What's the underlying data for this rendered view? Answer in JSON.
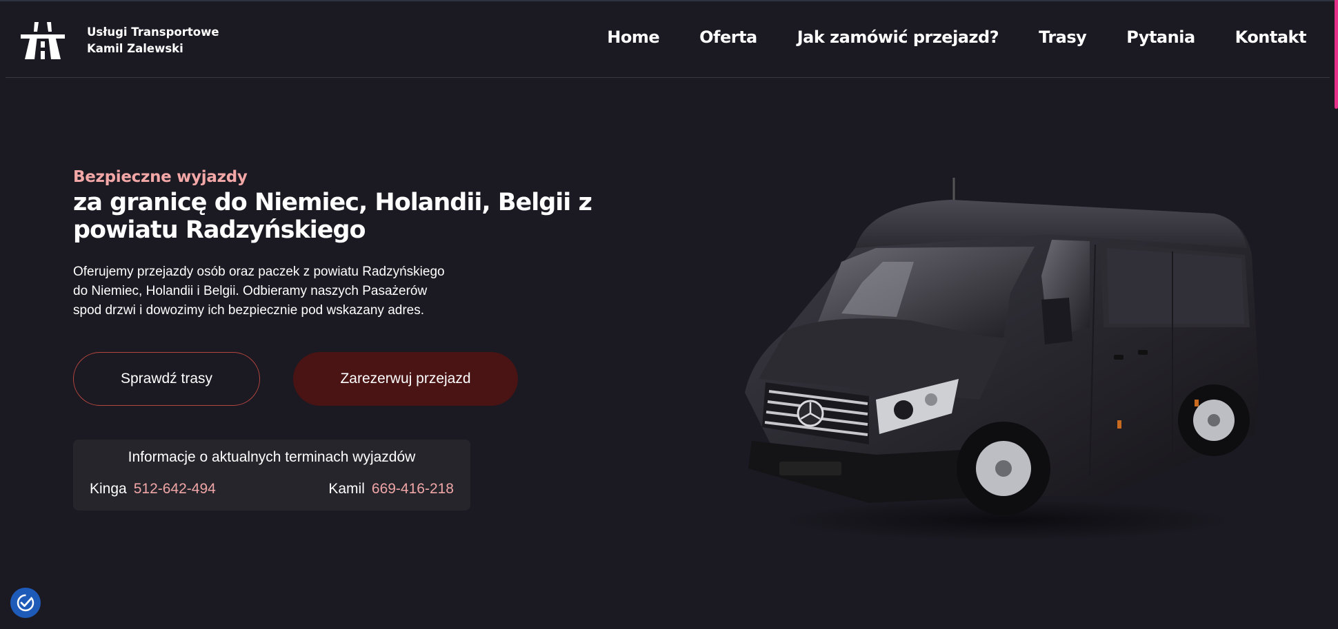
{
  "brand": {
    "line1": "Usługi Transportowe",
    "line2": "Kamil Zalewski"
  },
  "nav": {
    "items": [
      {
        "label": "Home"
      },
      {
        "label": "Oferta"
      },
      {
        "label": "Jak zamówić przejazd?"
      },
      {
        "label": "Trasy"
      },
      {
        "label": "Pytania"
      },
      {
        "label": "Kontakt"
      }
    ]
  },
  "hero": {
    "eyebrow": "Bezpieczne wyjazdy",
    "headline_line1": "za granicę do Niemiec, Holandii, Belgii z",
    "headline_line2": "powiatu Radzyńskiego",
    "lead_line1": "Oferujemy przejazdy osób oraz paczek z powiatu Radzyńskiego",
    "lead_line2": "do Niemiec, Holandii i Belgii. Odbieramy naszych Pasażerów",
    "lead_line3": "spod drzwi i dowozimy ich bezpiecznie pod wskazany adres.",
    "cta_secondary": "Sprawdź trasy",
    "cta_primary": "Zarezerwuj przejazd"
  },
  "info_card": {
    "title": "Informacje o aktualnych terminach wyjazdów",
    "contacts": [
      {
        "name": "Kinga",
        "phone": "512-642-494"
      },
      {
        "name": "Kamil",
        "phone": "669-416-218"
      }
    ]
  },
  "colors": {
    "background": "#1b1a22",
    "accent_pink": "#f3a7a7",
    "button_primary": "#4a1314",
    "button_outline": "#b4453f",
    "card": "#26252c",
    "scroll_indicator": "#e6318a",
    "a11y_button": "#1e5bb8"
  },
  "icons": {
    "logo": "highway-road-icon",
    "accessibility": "accessibility-check-icon"
  }
}
